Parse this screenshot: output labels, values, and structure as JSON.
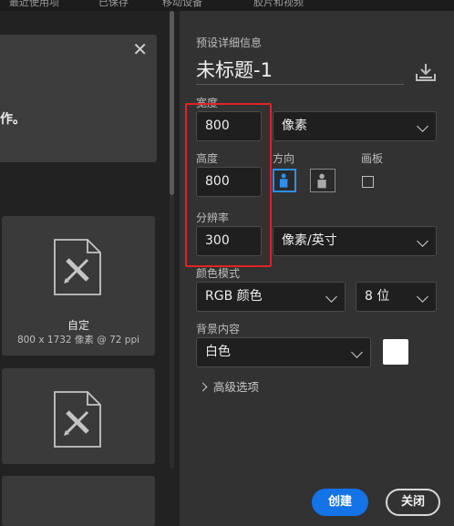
{
  "top_tabs": [
    "最近使用项",
    "已保存",
    "移动设备",
    "胶片和视频"
  ],
  "left": {
    "panel_text_tail": "作。",
    "cards": [
      {
        "name": "自定",
        "meta": "800 x 1732 像素 @ 72 ppi",
        "icon": "document-ruler-icon"
      },
      {
        "icon": "document-ruler-icon"
      },
      {}
    ]
  },
  "details": {
    "heading": "预设详细信息",
    "doc_title": "未标题-1",
    "width_label": "宽度",
    "width_value": "800",
    "width_unit": "像素",
    "height_label": "高度",
    "height_value": "800",
    "orientation_label": "方向",
    "artboard_label": "画板",
    "resolution_label": "分辨率",
    "resolution_value": "300",
    "resolution_unit": "像素/英寸",
    "color_mode_label": "颜色模式",
    "color_mode_value": "RGB 颜色",
    "bit_depth_value": "8 位",
    "background_label": "背景内容",
    "background_value": "白色",
    "background_swatch": "#ffffff",
    "advanced_label": "高级选项"
  },
  "buttons": {
    "create": "创建",
    "close": "关闭"
  },
  "colors": {
    "accent": "#1473e6",
    "orientation_active": "#2e8ef2",
    "highlight": "#e02424"
  }
}
